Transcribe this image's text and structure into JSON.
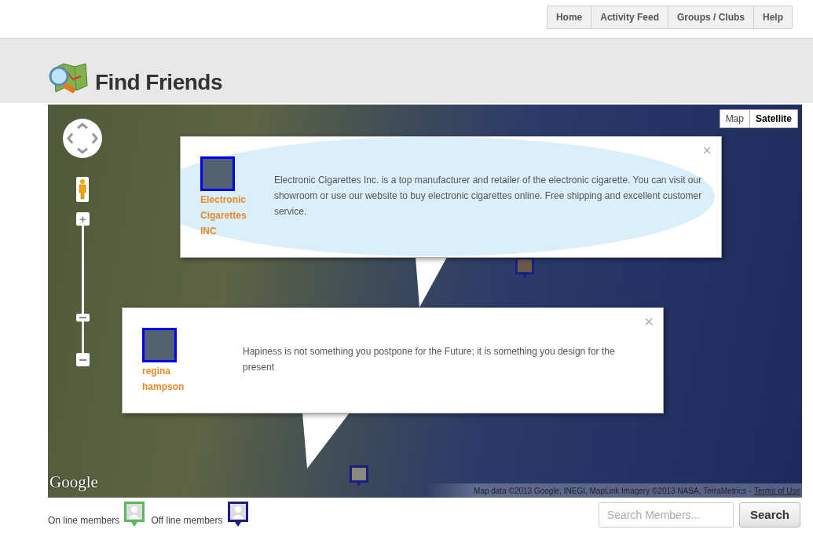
{
  "nav": [
    {
      "label": "Home",
      "selected": false
    },
    {
      "label": "Activity Feed",
      "selected": false
    },
    {
      "label": "Groups / Clubs",
      "selected": false
    },
    {
      "label": "Help",
      "selected": false
    }
  ],
  "page": {
    "title": "Find Friends"
  },
  "map": {
    "map_types": [
      {
        "label": "Map",
        "selected": false
      },
      {
        "label": "Satellite",
        "selected": true
      }
    ],
    "zoom": {
      "level": 0.26,
      "zoom_in": "+"
    },
    "info_windows": [
      {
        "name": "Electronic Cigarettes INC",
        "text": "Electronic Cigarettes Inc. is a top manufacturer and retailer of the electronic cigarette. You can visit our showroom or use our website to buy electronic cigarettes online. Free shipping and excellent customer service.",
        "close": "×",
        "highlighted": true
      },
      {
        "name": "regina hampson",
        "text": "Hapiness is not something you postpone for the Future; it is something you design for the present",
        "close": "×",
        "highlighted": false
      }
    ],
    "logo": "Google",
    "attribution": "Map data ©2013 Google, INEGI, MapLink Imagery ©2013 NASA, TerraMetrics -",
    "terms_link": "Terms of Use"
  },
  "legend": [
    {
      "label": "On line members",
      "color": "#5cb85c"
    },
    {
      "label": "Off line members",
      "color": "#1e1e82"
    }
  ],
  "search": {
    "placeholder": "Search Members...",
    "button": "Search"
  }
}
